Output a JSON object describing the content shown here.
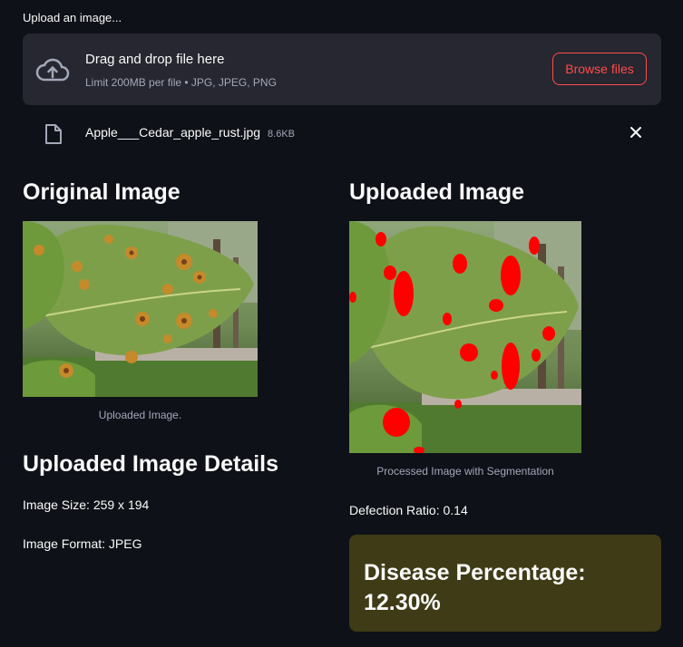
{
  "uploader": {
    "label": "Upload an image...",
    "drop_title": "Drag and drop file here",
    "drop_subtitle": "Limit 200MB per file • JPG, JPEG, PNG",
    "browse_label": "Browse files",
    "icon": "cloud-upload-icon"
  },
  "file": {
    "name": "Apple___Cedar_apple_rust.jpg",
    "size": "8.6KB",
    "icon": "file-icon",
    "remove_icon": "close-icon"
  },
  "left": {
    "title": "Original Image",
    "caption": "Uploaded Image.",
    "details_title": "Uploaded Image Details",
    "size_text": "Image Size: 259 x 194",
    "format_text": "Image Format: JPEG"
  },
  "right": {
    "title": "Uploaded Image",
    "caption": "Processed Image with Segmentation",
    "ratio_text": "Defection Ratio: 0.14",
    "disease_text": "Disease Percentage: 12.30%"
  },
  "colors": {
    "accent": "#ff4b4b",
    "background": "#0e1117",
    "panel": "#262730",
    "highlight_box": "#3e3b16",
    "segmentation": "#ff0000"
  }
}
